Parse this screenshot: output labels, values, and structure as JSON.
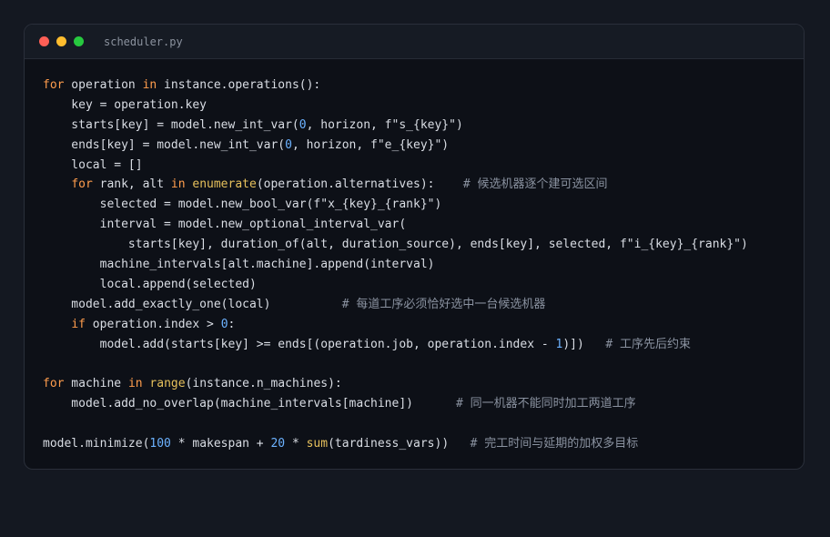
{
  "window": {
    "filename": "scheduler.py",
    "colors": {
      "close": "#ff5f56",
      "minimize": "#ffbd2e",
      "maximize": "#27c93f"
    }
  },
  "code": {
    "lines": [
      [
        {
          "t": "kw",
          "v": "for"
        },
        {
          "t": "plain",
          "v": " operation "
        },
        {
          "t": "kw",
          "v": "in"
        },
        {
          "t": "plain",
          "v": " instance.operations():"
        }
      ],
      [
        {
          "t": "plain",
          "v": "    key = operation.key"
        }
      ],
      [
        {
          "t": "plain",
          "v": "    starts[key] = model.new_int_var("
        },
        {
          "t": "num",
          "v": "0"
        },
        {
          "t": "plain",
          "v": ", horizon, f\"s_{key}\")"
        }
      ],
      [
        {
          "t": "plain",
          "v": "    ends[key] = model.new_int_var("
        },
        {
          "t": "num",
          "v": "0"
        },
        {
          "t": "plain",
          "v": ", horizon, f\"e_{key}\")"
        }
      ],
      [
        {
          "t": "plain",
          "v": "    local = []"
        }
      ],
      [
        {
          "t": "plain",
          "v": "    "
        },
        {
          "t": "kw",
          "v": "for"
        },
        {
          "t": "plain",
          "v": " rank, alt "
        },
        {
          "t": "kw",
          "v": "in"
        },
        {
          "t": "plain",
          "v": " "
        },
        {
          "t": "fn",
          "v": "enumerate"
        },
        {
          "t": "plain",
          "v": "(operation.alternatives):    "
        },
        {
          "t": "cm",
          "v": "# 候选机器逐个建可选区间"
        }
      ],
      [
        {
          "t": "plain",
          "v": "        selected = model.new_bool_var(f\"x_{key}_{rank}\")"
        }
      ],
      [
        {
          "t": "plain",
          "v": "        interval = model.new_optional_interval_var("
        }
      ],
      [
        {
          "t": "plain",
          "v": "            starts[key], duration_of(alt, duration_source), ends[key], selected, f\"i_{key}_{rank}\")"
        }
      ],
      [
        {
          "t": "plain",
          "v": "        machine_intervals[alt.machine].append(interval)"
        }
      ],
      [
        {
          "t": "plain",
          "v": "        local.append(selected)"
        }
      ],
      [
        {
          "t": "plain",
          "v": "    model.add_exactly_one(local)          "
        },
        {
          "t": "cm",
          "v": "# 每道工序必须恰好选中一台候选机器"
        }
      ],
      [
        {
          "t": "plain",
          "v": "    "
        },
        {
          "t": "kw",
          "v": "if"
        },
        {
          "t": "plain",
          "v": " operation.index > "
        },
        {
          "t": "num",
          "v": "0"
        },
        {
          "t": "plain",
          "v": ":"
        }
      ],
      [
        {
          "t": "plain",
          "v": "        model.add(starts[key] >= ends[(operation.job, operation.index - "
        },
        {
          "t": "num",
          "v": "1"
        },
        {
          "t": "plain",
          "v": ")])   "
        },
        {
          "t": "cm",
          "v": "# 工序先后约束"
        }
      ],
      [
        {
          "t": "plain",
          "v": ""
        }
      ],
      [
        {
          "t": "kw",
          "v": "for"
        },
        {
          "t": "plain",
          "v": " machine "
        },
        {
          "t": "kw",
          "v": "in"
        },
        {
          "t": "plain",
          "v": " "
        },
        {
          "t": "fn",
          "v": "range"
        },
        {
          "t": "plain",
          "v": "(instance.n_machines):"
        }
      ],
      [
        {
          "t": "plain",
          "v": "    model.add_no_overlap(machine_intervals[machine])      "
        },
        {
          "t": "cm",
          "v": "# 同一机器不能同时加工两道工序"
        }
      ],
      [
        {
          "t": "plain",
          "v": ""
        }
      ],
      [
        {
          "t": "plain",
          "v": "model.minimize("
        },
        {
          "t": "num",
          "v": "100"
        },
        {
          "t": "plain",
          "v": " * makespan + "
        },
        {
          "t": "num",
          "v": "20"
        },
        {
          "t": "plain",
          "v": " * "
        },
        {
          "t": "fn",
          "v": "sum"
        },
        {
          "t": "plain",
          "v": "(tardiness_vars))   "
        },
        {
          "t": "cm",
          "v": "# 完工时间与延期的加权多目标"
        }
      ]
    ]
  }
}
